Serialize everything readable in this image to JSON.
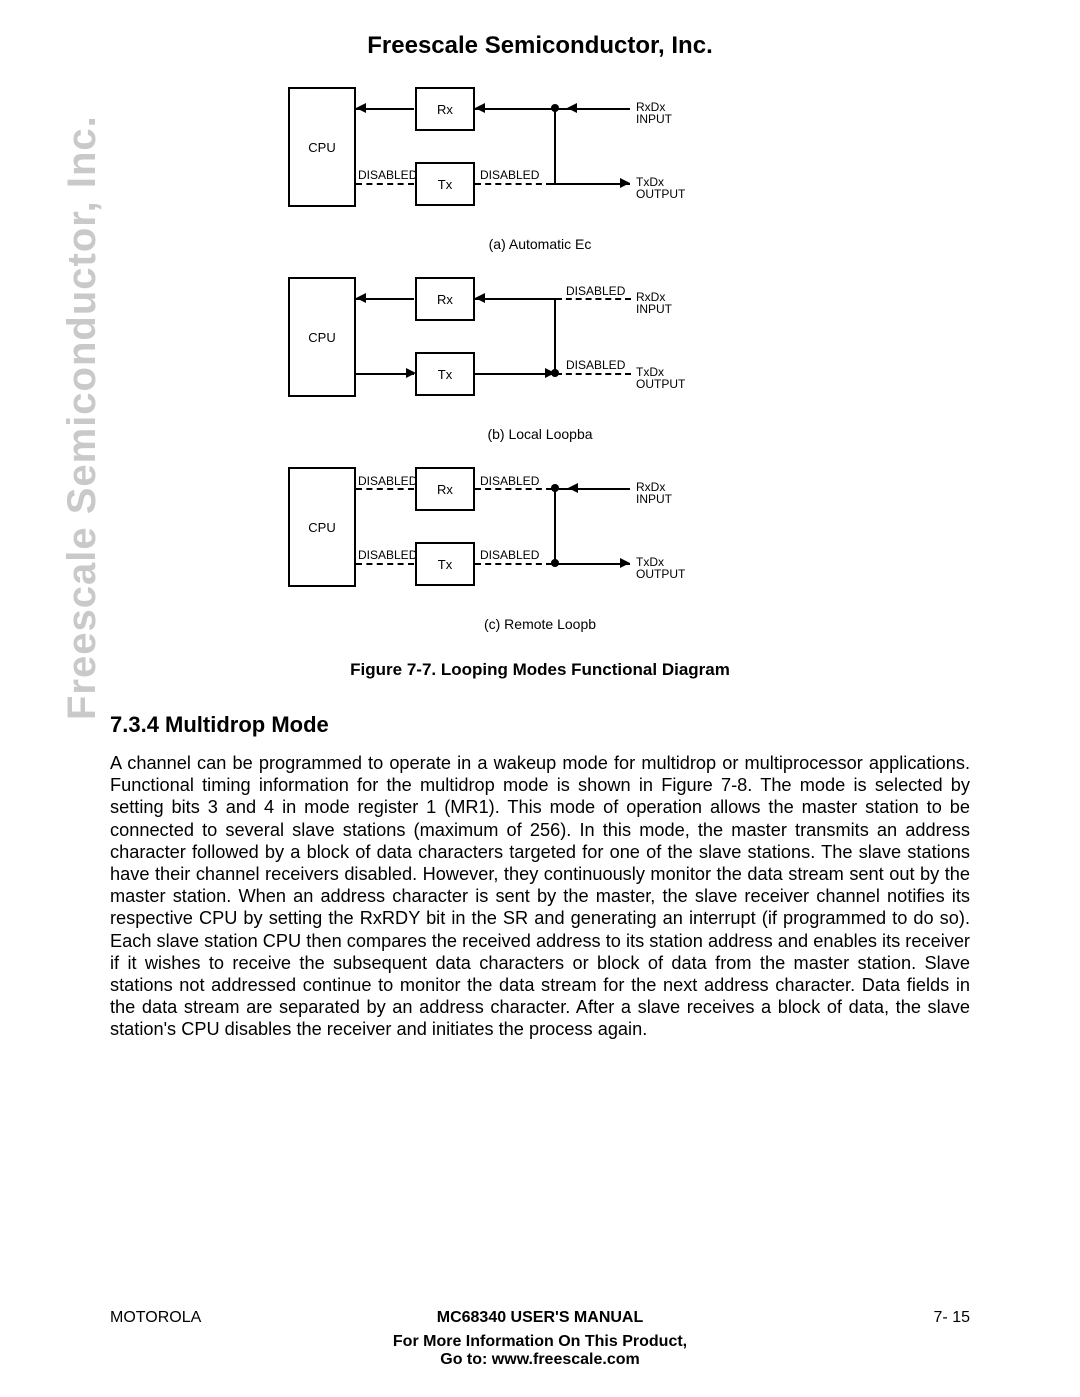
{
  "header": {
    "company": "Freescale Semiconductor, Inc."
  },
  "watermark": "Freescale Semiconductor, Inc.",
  "diagram": {
    "cpu": "CPU",
    "rx": "Rx",
    "tx": "Tx",
    "disabled": "DISABLED",
    "rxdx": "RxDx",
    "txdx": "TxDx",
    "input": "INPUT",
    "output": "OUTPUT",
    "caption_a": "(a) Automatic Ec",
    "caption_b": "(b) Local Loopba",
    "caption_c": "(c) Remote Loopb"
  },
  "figure_title": "Figure 7-7. Looping Modes Functional Diagram",
  "section": {
    "heading": "7.3.4 Multidrop Mode",
    "body": "A channel can be programmed to operate in a wakeup mode for multidrop or multiprocessor applications. Functional timing information for the multidrop mode is shown in Figure 7-8. The mode is selected by setting bits 3 and 4 in mode register 1 (MR1). This mode of operation allows the master station to be connected to several slave stations (maximum of 256). In this mode, the master transmits an address character followed by a block of data characters targeted for one of the slave stations. The slave stations have their channel receivers disabled. However, they continuously monitor the data stream sent out by the master station. When an address character is sent by the master, the slave receiver channel notifies its respective CPU by setting the RxRDY bit in the SR and generating an interrupt (if programmed to do so). Each slave station CPU then compares the received address to its station address and enables its receiver if it wishes to receive the subsequent data characters or block of data from the master station. Slave stations not addressed continue to monitor the data stream for the next address character. Data fields in the data stream are separated by an address character. After a slave receives a block of data, the slave station's CPU disables the receiver and initiates the process again."
  },
  "footer": {
    "left": "MOTOROLA",
    "center": "MC68340 USER'S MANUAL",
    "right": "7- 15",
    "line1": "For More Information On This Product,",
    "line2": "Go to: www.freescale.com"
  }
}
